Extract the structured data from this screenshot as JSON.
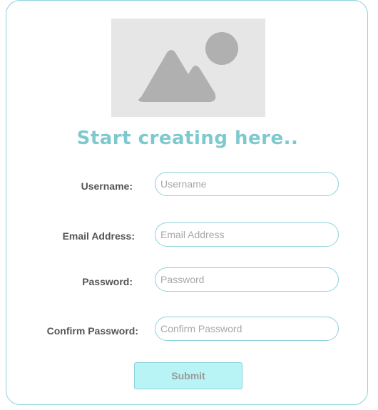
{
  "hero": {
    "icon": "image-placeholder-icon",
    "colors": {
      "background": "#e6e6e6",
      "shapes": "#b0b0b0"
    }
  },
  "form": {
    "title": "Start creating here..",
    "fields": {
      "username": {
        "label": "Username:",
        "placeholder": "Username",
        "value": ""
      },
      "email": {
        "label": "Email Address:",
        "placeholder": "Email Address",
        "value": ""
      },
      "password": {
        "label": "Password:",
        "placeholder": "Password",
        "value": ""
      },
      "confirm_password": {
        "label": "Confirm Password:",
        "placeholder": "Confirm Password",
        "value": ""
      }
    },
    "submit_label": "Submit"
  },
  "colors": {
    "accent": "#7ec9cf",
    "border": "#8dd2dc",
    "submit_background": "#b8f3f6",
    "label_text": "#555555"
  }
}
